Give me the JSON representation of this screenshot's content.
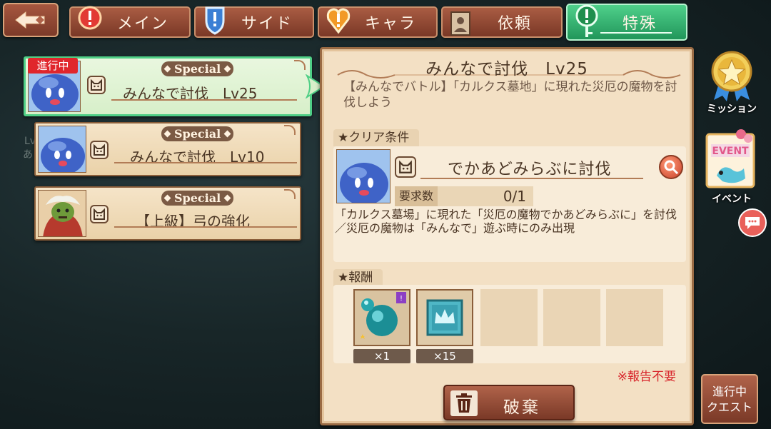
{
  "tabs": [
    {
      "label": "メイン",
      "icon": "red-exclamation-badge-icon"
    },
    {
      "label": "サイド",
      "icon": "blue-exclamation-shield-icon"
    },
    {
      "label": "キャラ",
      "icon": "orange-heart-exclamation-icon"
    },
    {
      "label": "依頼",
      "icon": "portrait-frame-icon"
    },
    {
      "label": "特殊",
      "icon": "green-key-exclamation-icon",
      "active": true
    }
  ],
  "quests": [
    {
      "badge": "Special",
      "title": "みんなで討伐　Lv25",
      "status": "進行中",
      "selected": true
    },
    {
      "badge": "Special",
      "title": "みんなで討伐　Lv10"
    },
    {
      "badge": "Special",
      "title": "【上級】弓の強化"
    }
  ],
  "background_fragments": {
    "lv_fragment": "Lv",
    "a_fragment": "あ"
  },
  "detail": {
    "title": "みんなで討伐　Lv25",
    "description": "【みんなでバトル】「カルクス墓地」に現れた災厄の魔物を討伐しよう",
    "clear_header": "クリア条件",
    "target": "でかあどみらぶに討伐",
    "required_label": "要求数",
    "required_value": "0/1",
    "condition_note": "「カルクス墓場」に現れた「災厄の魔物でかあどみらぶに」を討伐／災厄の魔物は「みんなで」遊ぶ時にのみ出現",
    "reward_header": "報酬",
    "rewards": [
      {
        "item": "teal-slime-orb",
        "quantity": "×1"
      },
      {
        "item": "blue-crown-tile",
        "quantity": "×15"
      }
    ],
    "no_report": "※報告不要",
    "discard_label": "破棄"
  },
  "side": {
    "mission_label": "ミッション",
    "event_label": "イベント",
    "event_card_text": "EVENT",
    "progress_label_1": "進行中",
    "progress_label_2": "クエスト"
  },
  "colors": {
    "active_tab": "#2fae6a",
    "selected_card": "#4fcf86",
    "button": "#9a4d37",
    "notice": "#d8262c"
  }
}
